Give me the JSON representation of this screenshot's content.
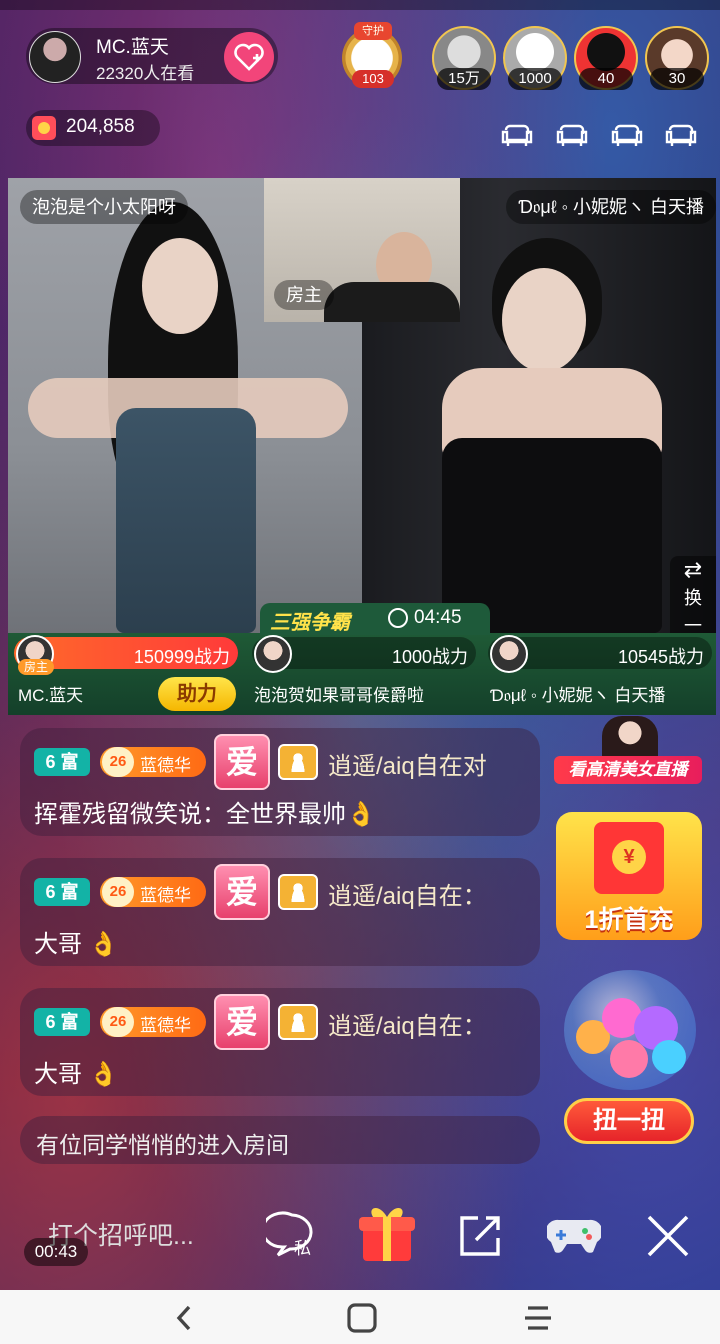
{
  "header": {
    "host_name": "MC.蓝天",
    "viewers": "22320人在看",
    "guard_label": "守护",
    "guard_count": "103",
    "fans": [
      {
        "count": "15万"
      },
      {
        "count": "1000"
      },
      {
        "count": "40"
      },
      {
        "count": "30"
      }
    ],
    "coins": "204,858"
  },
  "video": {
    "left_name": "泡泡是个小太阳呀",
    "right_name": "Ɗ𝔬μℓ ◦ 小妮妮ヽ 白天播",
    "pip_label": "房主",
    "swap_label": "换一个"
  },
  "battle": {
    "title": "三强争霸",
    "time": "04:45",
    "teams": [
      {
        "power": "150999战力",
        "name": "MC.蓝天",
        "badge": "房主",
        "fill": 1.0
      },
      {
        "power": "1000战力",
        "name": "泡泡贺如果哥哥侯爵啦",
        "fill": 0.0
      },
      {
        "power": "10545战力",
        "name": "Ɗ𝔬μℓ ◦ 小妮妮ヽ 白天播",
        "fill": 0.0
      }
    ],
    "assist_label": "助力"
  },
  "chat": [
    {
      "level": "6 富",
      "fan_level": "26",
      "fan_name": "蓝德华",
      "love": "爱",
      "user": "逍遥/aiq自在对",
      "message": "挥霍残留微笑说：全世界最帅👌"
    },
    {
      "level": "6 富",
      "fan_level": "26",
      "fan_name": "蓝德华",
      "love": "爱",
      "user": "逍遥/aiq自在：",
      "message": "大哥 👌"
    },
    {
      "level": "6 富",
      "fan_level": "26",
      "fan_name": "蓝德华",
      "love": "爱",
      "user": "逍遥/aiq自在：",
      "message": "大哥 👌"
    }
  ],
  "system_message": "有位同学悄悄的进入房间",
  "promos": {
    "hd_label": "看高清美女直播",
    "recharge_symbol": "¥",
    "recharge_label": "1折首充",
    "gacha_label": "扭一扭"
  },
  "bottom": {
    "input_placeholder": "打个招呼吧...",
    "duration": "00:43",
    "private_label": "私"
  },
  "colors": {
    "accent_pink": "#f2457a",
    "battle_green": "#1f5a36",
    "gold": "#f1c650"
  }
}
